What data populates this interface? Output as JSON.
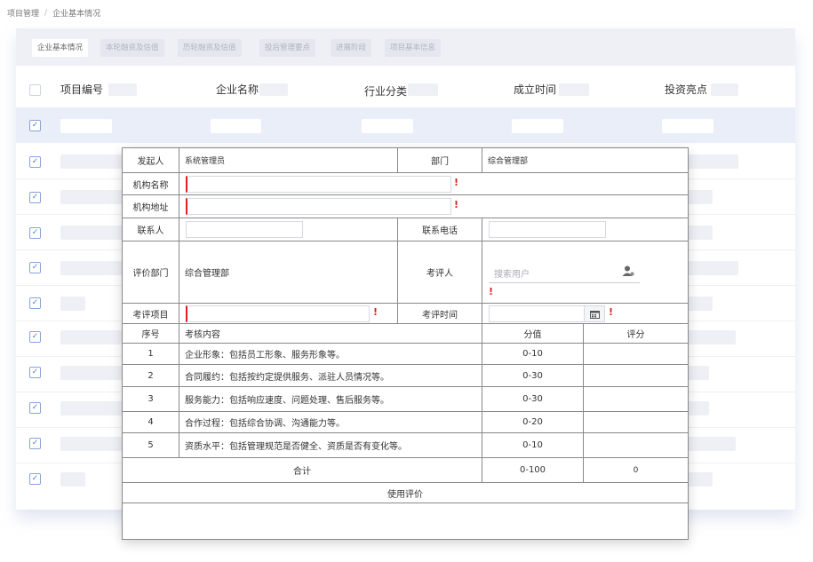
{
  "breadcrumb": {
    "root": "项目管理",
    "separator": "/",
    "current": "企业基本情况"
  },
  "tabs": [
    {
      "label": "企业基本情况",
      "active": true
    },
    {
      "label": "本轮融资及估值",
      "active": false
    },
    {
      "label": "历轮融资及估值",
      "active": false
    },
    {
      "label": "投后管理要点",
      "active": false
    },
    {
      "label": "进展阶段",
      "active": false
    },
    {
      "label": "项目基本信息",
      "active": false
    }
  ],
  "table": {
    "headers": {
      "project_no": "项目编号",
      "company": "企业名称",
      "industry": "行业分类",
      "founded": "成立时间",
      "highlights": "投资亮点"
    }
  },
  "dialog": {
    "initiator_label": "发起人",
    "initiator_value": "系统管理员",
    "dept_label": "部门",
    "dept_value": "综合管理部",
    "org_name_label": "机构名称",
    "org_addr_label": "机构地址",
    "contact_label": "联系人",
    "phone_label": "联系电话",
    "eval_dept_label": "评价部门",
    "eval_dept_value": "综合管理部",
    "evaluator_label": "考评人",
    "evaluator_placeholder": "搜索用户",
    "eval_item_label": "考评项目",
    "eval_time_label": "考评时间",
    "required_mark": "!",
    "score_table": {
      "headers": {
        "no": "序号",
        "content": "考核内容",
        "range": "分值",
        "score": "评分"
      },
      "rows": [
        {
          "no": "1",
          "content": "企业形象：包括员工形象、服务形象等。",
          "range": "0-10"
        },
        {
          "no": "2",
          "content": "合同履约：包括按约定提供服务、派驻人员情况等。",
          "range": "0-30"
        },
        {
          "no": "3",
          "content": "服务能力：包括响应速度、问题处理、售后服务等。",
          "range": "0-30"
        },
        {
          "no": "4",
          "content": "合作过程：包括综合协调、沟通能力等。",
          "range": "0-20"
        },
        {
          "no": "5",
          "content": "资质水平：包括管理规范是否健全、资质是否有变化等。",
          "range": "0-10"
        }
      ],
      "total_label": "合计",
      "total_range": "0-100",
      "total_score": "0"
    },
    "usage_label": "使用评价"
  },
  "colors": {
    "accent": "#5b7cc4",
    "required": "#e02020",
    "highlight_row": "#e9eef8"
  },
  "icons": {
    "checkbox": "check-icon",
    "user": "user-icon",
    "calendar": "calendar-icon"
  }
}
